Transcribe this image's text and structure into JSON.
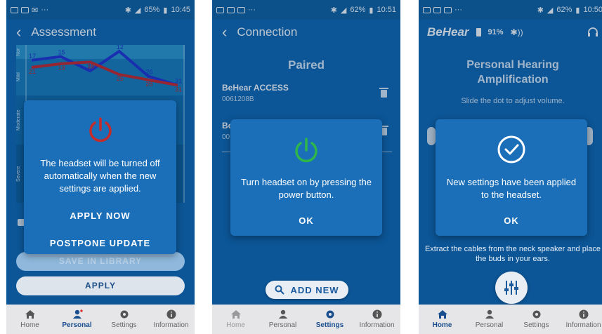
{
  "screen1": {
    "status": {
      "battery": "65%",
      "time": "10:45"
    },
    "title": "Assessment",
    "chart_data": {
      "type": "line",
      "bands": [
        "Normal",
        "Mild",
        "Moderate",
        "Severe"
      ],
      "band_labels": [
        "Nor",
        "Mild",
        "Moderate",
        "Severe"
      ],
      "series": [
        {
          "color": "#1f2fd1",
          "values": [
            17,
            15,
            23,
            12,
            26,
            31
          ],
          "labels": [
            "17",
            "15",
            "23",
            "12",
            "26",
            "31"
          ]
        },
        {
          "color": "#cc2222",
          "values": [
            21,
            19,
            18,
            25,
            28,
            31
          ],
          "labels": [
            "21",
            "19",
            "18",
            "25",
            "28",
            "31"
          ]
        }
      ]
    },
    "dialog": {
      "message": "The headset will be turned off automatically when the new settings are applied.",
      "apply_now": "APPLY NOW",
      "postpone": "POSTPONE UPDATE"
    },
    "save_in_library": "SAVE IN LIBRARY",
    "apply": "APPLY",
    "nav": [
      {
        "label": "Home",
        "icon": "home-icon"
      },
      {
        "label": "Personal",
        "icon": "person-icon"
      },
      {
        "label": "Settings",
        "icon": "gear-icon"
      },
      {
        "label": "Information",
        "icon": "info-icon"
      }
    ],
    "active_nav": "Personal"
  },
  "screen2": {
    "status": {
      "battery": "62%",
      "time": "10:51"
    },
    "title": "Connection",
    "heading": "Paired",
    "devices": [
      {
        "name": "BeHear ACCESS",
        "id": "0061208B"
      },
      {
        "name": "Be",
        "id": "00"
      }
    ],
    "dialog": {
      "message": "Turn headset on by pressing the power button.",
      "ok": "OK"
    },
    "add_new": "ADD NEW",
    "nav": [
      {
        "label": "Home",
        "icon": "home-icon"
      },
      {
        "label": "Personal",
        "icon": "person-icon"
      },
      {
        "label": "Settings",
        "icon": "gear-icon"
      },
      {
        "label": "Information",
        "icon": "info-icon"
      }
    ],
    "active_nav": "Settings"
  },
  "screen3": {
    "status": {
      "battery": "62%",
      "time": "10:50"
    },
    "brand": "BeHear",
    "headset_battery": "91%",
    "heading_line1": "Personal Hearing",
    "heading_line2": "Amplification",
    "subtitle": "Slide the dot to adjust volume.",
    "dialog": {
      "message": "New settings have been applied to the headset.",
      "ok": "OK"
    },
    "instruction": "Extract the cables from the neck speaker and place the buds in your ears.",
    "nav": [
      {
        "label": "Home",
        "icon": "home-icon"
      },
      {
        "label": "Personal",
        "icon": "person-icon"
      },
      {
        "label": "Settings",
        "icon": "gear-icon"
      },
      {
        "label": "Information",
        "icon": "info-icon"
      }
    ],
    "active_nav": "Home"
  },
  "colors": {
    "primary": "#0d63ad",
    "dialog": "#1b6fb8",
    "power_off": "#c42b2b",
    "power_on": "#2fb64a",
    "nav_bg": "#e6e6e8"
  }
}
